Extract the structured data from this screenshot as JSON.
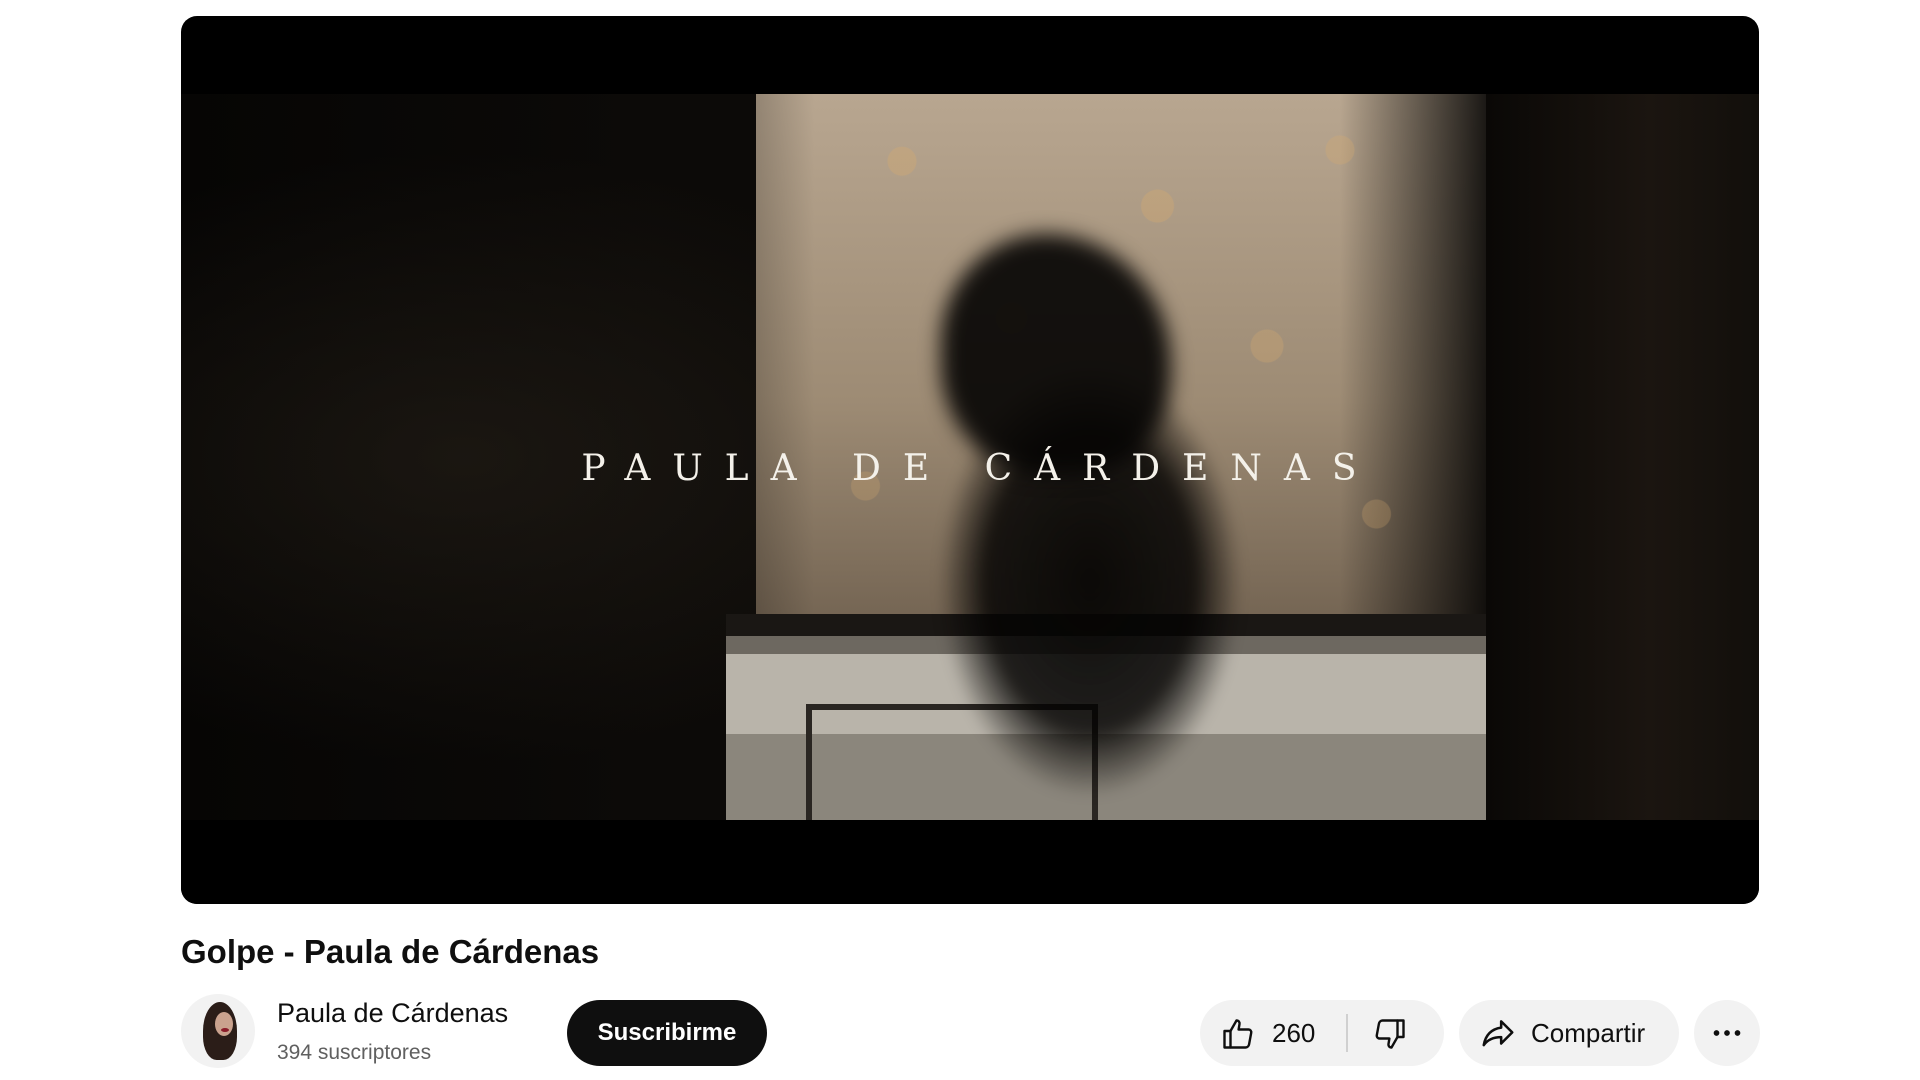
{
  "player": {
    "overlay_text": "PAULA DE CÁRDENAS"
  },
  "video": {
    "title": "Golpe - Paula de Cárdenas"
  },
  "channel": {
    "name": "Paula de Cárdenas",
    "subscribers": "394 suscriptores",
    "subscribe_label": "Suscribirme"
  },
  "actions": {
    "like_count": "260",
    "share_label": "Compartir"
  },
  "icons": {
    "like": "thumbs-up-icon",
    "dislike": "thumbs-down-icon",
    "share": "share-arrow-icon",
    "more": "more-horizontal-icon"
  },
  "colors": {
    "subscribe_bg": "#0f0f0f",
    "pill_bg": "#f2f2f2",
    "text_primary": "#0f0f0f",
    "text_secondary": "#606060"
  }
}
